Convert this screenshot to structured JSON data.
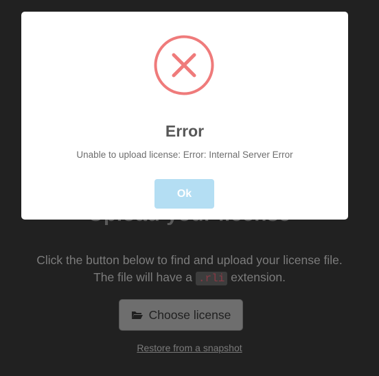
{
  "background": {
    "heading": "Upload your license",
    "description_line1": "Click the button below to find and upload your license file.",
    "description_line2_prefix": "The file will have a ",
    "description_code": ".rli",
    "description_line2_suffix": " extension.",
    "choose_button_label": "Choose license",
    "choose_button_icon": "folder-open-icon",
    "restore_link_label": "Restore from a snapshot"
  },
  "modal": {
    "icon": "error-x-icon",
    "title": "Error",
    "message": "Unable to upload license: Error: Internal Server Error",
    "ok_label": "Ok"
  },
  "colors": {
    "page_background": "#212121",
    "error_red": "#ef7b7b",
    "ok_button": "#b4def3"
  }
}
